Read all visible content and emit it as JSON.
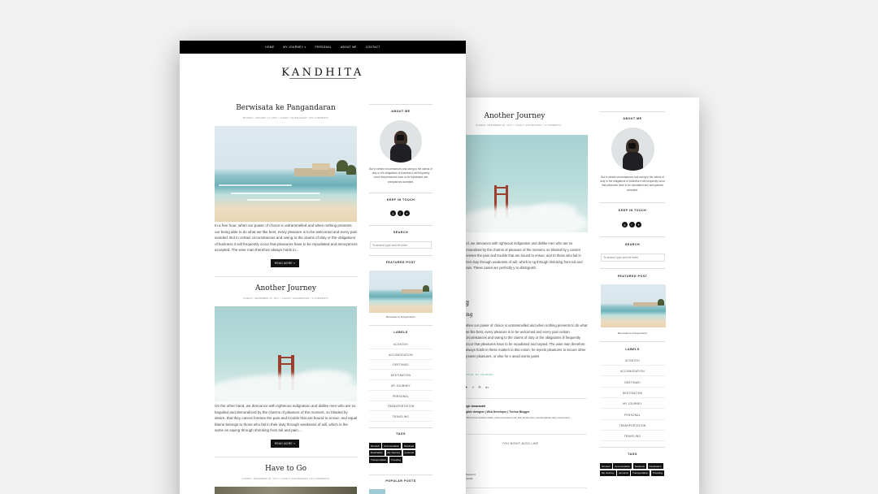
{
  "nav": {
    "items": [
      {
        "label": "HOME"
      },
      {
        "label": "MY JOURNEY ▾"
      },
      {
        "label": "PERSONAL"
      },
      {
        "label": "ABOUT ME"
      },
      {
        "label": "CONTACT"
      }
    ]
  },
  "site": {
    "logo": "KANDHITA"
  },
  "posts": [
    {
      "title": "Berwisata ke Pangandaran",
      "meta": "MONDAY, JANUARY 11, 2016  |  LASGUY ANAKBANGET  |  NO COMMENTS",
      "excerpt": "In a free hour, when our power of choice is untrammelled and when nothing prevents our being able to do what we like best, every pleasure is to be welcomed and every pain avoided. But in certain circumstances and owing to the claims of duty or the obligations of business it will frequently occur that pleasures have to be repudiated and annoyances accepted. The wise man therefore always holds in...",
      "read_more": "READ MORE »"
    },
    {
      "title": "Another Journey",
      "meta": "SUNDAY, DECEMBER 06, 2017  |  LASGUY ANAKBANGET  |  2 COMMENTS",
      "excerpt": "On the other hand, we denounce with righteous indignation and dislike men who are so beguiled and demoralized by the charms of pleasure of the moment, so blinded by desire, that they cannot foresee the pain and trouble that are bound to ensue; and equal blame belongs to those who fail in their duty through weakness of will, which is the same as saying through shrinking from toil and pain....",
      "read_more": "READ MORE »"
    },
    {
      "title": "Have to Go",
      "meta": "SUNDAY, DECEMBER 06, 2017  |  LASGUY ANAKBANGET  |  NO COMMENTS"
    }
  ],
  "sidebar": {
    "about_title": "ABOUT ME",
    "about_text": "But in certain circumstances and owing to the claims of duty or the obligations of business it will frequently occur that pleasures have to be repudiated and annoyances accepted.",
    "keep_title": "KEEP IN TOUCH",
    "social_icons": [
      "instagram-icon",
      "facebook-icon",
      "twitter-icon"
    ],
    "search_title": "SEARCH",
    "search_placeholder": "To search type and hit enter",
    "featured_title": "FEATURED POST",
    "featured_caption": "Berwisata ke Pangandaran",
    "labels_title": "LABELS",
    "labels": [
      "#CONTOH",
      "ACCOMODATION",
      "DESTINASI",
      "DESTINATION",
      "MY JOURNEY",
      "PERSONAL",
      "TRANSPORTATION",
      "TRAVELING"
    ],
    "tags_title": "TAGS",
    "tags": [
      "#contoh",
      "Accomodation",
      "Destinasi",
      "Destination",
      "My Journey",
      "personal",
      "Transportation",
      "Traveling"
    ],
    "popular_title": "POPULAR POSTS"
  },
  "single": {
    "title": "Another Journey",
    "meta": "SUNDAY, DECEMBER 06, 2017  |  LASGUY ANAKBANGET  |  2 COMMENTS",
    "p1": "nd, we denounce with righteous indignation and dislike men who are so emoralized by the charms of pleasure of the moment, so blinded by y cannot foresee the pain and trouble that are bound to ensue; and to those who fail in their duty through weakness of will, which is ng through shrinking from toil and pain. These cases are perfectly y to distinguish.",
    "h_g": "g",
    "h_ing": "ing",
    "p2": "when our power of choice is untrammelled and when nothing prevents to do what we like best, every pleasure is to be welcomed and every pain certain circumstances and owing to the claims of duty or the obligations ill frequently occur that pleasures have to be repudiated and cepted. The wise man therefore always holds in these matters to this ection: he rejects pleasures to secure other greater pleasures, or else he s avoid worse pains",
    "tags_line": "ATION, MY JOURNEY",
    "author_name": "ngh Amaravati",
    "author_role": "aphic designer | Web Developer | Techno Blogger",
    "author_bio": "Tribuh Kopi fundamentalis. Hobi membaca buku fiksi fantasi dan mendengarkan lagu campursari.",
    "might_like": "YOU MIGHT ALSO LIKE",
    "related_1": "Weekend",
    "related_2": "Kendal"
  }
}
